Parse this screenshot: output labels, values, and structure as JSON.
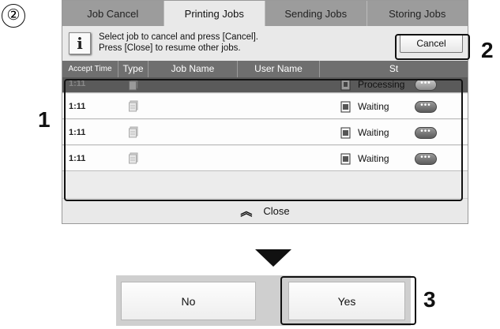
{
  "step_marker": "②",
  "tabs": [
    {
      "label": "Job Cancel",
      "active": false
    },
    {
      "label": "Printing Jobs",
      "active": true
    },
    {
      "label": "Sending Jobs",
      "active": false
    },
    {
      "label": "Storing Jobs",
      "active": false
    }
  ],
  "message": {
    "line1": "Select job to cancel and press [Cancel].",
    "line2": "Press [Close] to resume other jobs."
  },
  "cancel_label": "Cancel",
  "columns": {
    "accept_time": "Accept Time",
    "type": "Type",
    "job_name": "Job Name",
    "user_name": "User Name",
    "status": "St"
  },
  "jobs": [
    {
      "time": "1:11",
      "status": "Processing",
      "more": "•••"
    },
    {
      "time": "1:11",
      "status": "Waiting",
      "more": "•••"
    },
    {
      "time": "1:11",
      "status": "Waiting",
      "more": "•••"
    },
    {
      "time": "1:11",
      "status": "Waiting",
      "more": "•••"
    }
  ],
  "close_label": "Close",
  "confirm": {
    "no_label": "No",
    "yes_label": "Yes"
  },
  "callouts": {
    "one": "1",
    "two": "2",
    "three": "3"
  },
  "icons": {
    "type": "print-job-icon",
    "status": "document-status-icon",
    "close": "double-chevron-up-icon"
  }
}
